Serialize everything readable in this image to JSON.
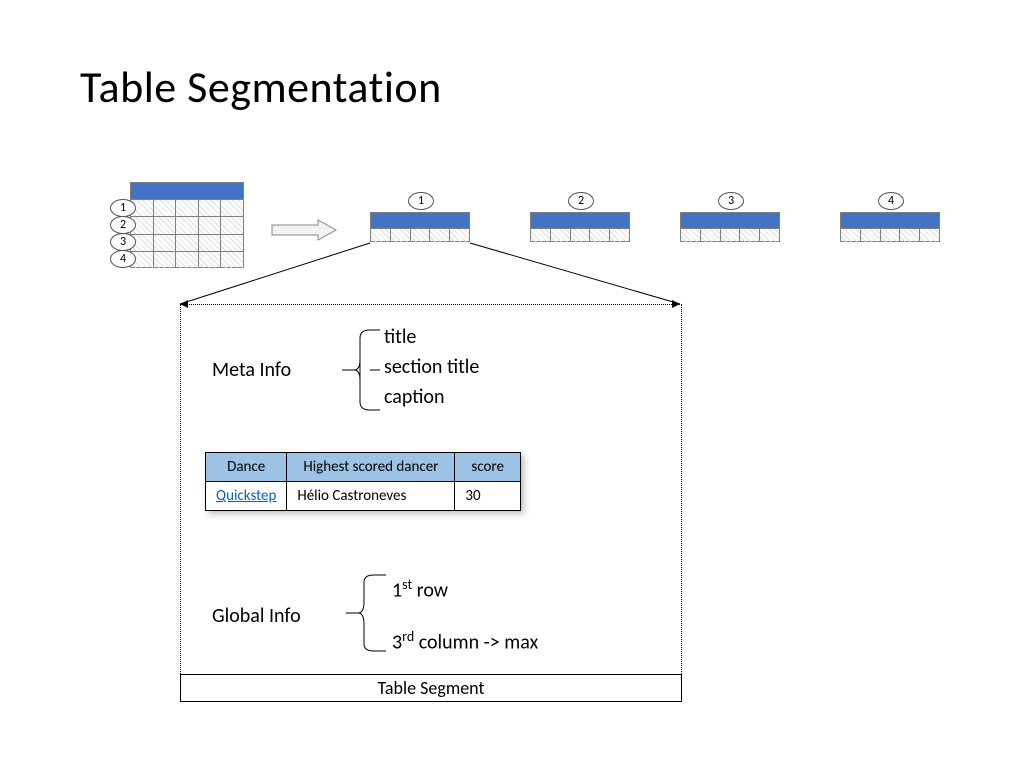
{
  "title": "Table Segmentation",
  "source_rows": [
    "1",
    "2",
    "3",
    "4"
  ],
  "segments": [
    "1",
    "2",
    "3",
    "4"
  ],
  "detail": {
    "meta_label": "Meta Info",
    "meta_items": [
      "title",
      "section title",
      "caption"
    ],
    "global_label": "Global Info",
    "global_items_html": [
      "1<sup>st</sup> row",
      "3<sup>rd</sup> column -> max"
    ],
    "caption": "Table Segment"
  },
  "example_table": {
    "headers": [
      "Dance",
      "Highest scored dancer",
      "score"
    ],
    "row": {
      "dance": "Quickstep",
      "dancer": "Hélio Castroneves",
      "score": "30"
    }
  }
}
